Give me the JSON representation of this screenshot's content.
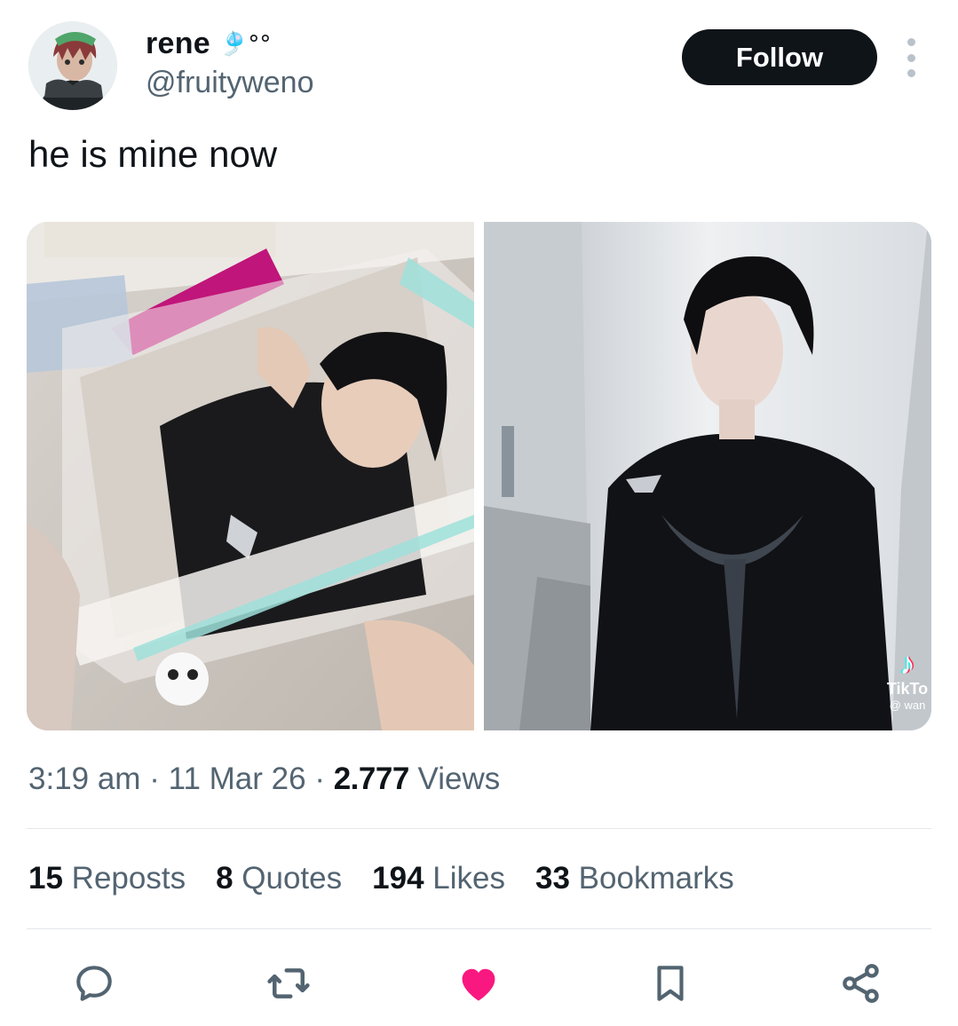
{
  "author": {
    "display_name": "rene",
    "name_emoji": "🎐°°",
    "handle": "@fruityweno",
    "avatar_icon": "anime-character-avatar"
  },
  "follow_label": "Follow",
  "tweet": {
    "text": "he is mine now"
  },
  "media": {
    "right_badge": {
      "note": "♪",
      "name": "TikTo",
      "user": "@ wan"
    }
  },
  "meta": {
    "time": "3:19 am",
    "date": "11 Mar 26",
    "views_count": "2.777",
    "views_label": "Views",
    "separator": "·"
  },
  "stats": [
    {
      "count": "15",
      "label": "Reposts"
    },
    {
      "count": "8",
      "label": "Quotes"
    },
    {
      "count": "194",
      "label": "Likes"
    },
    {
      "count": "33",
      "label": "Bookmarks"
    }
  ],
  "actions": [
    {
      "icon": "reply-icon"
    },
    {
      "icon": "repost-icon"
    },
    {
      "icon": "heart-icon",
      "color": "#f91880",
      "liked": true
    },
    {
      "icon": "bookmark-icon"
    },
    {
      "icon": "share-icon"
    }
  ],
  "colors": {
    "text_primary": "#0f1419",
    "text_secondary": "#536471",
    "like": "#f91880",
    "follow_bg": "#0f1419"
  }
}
